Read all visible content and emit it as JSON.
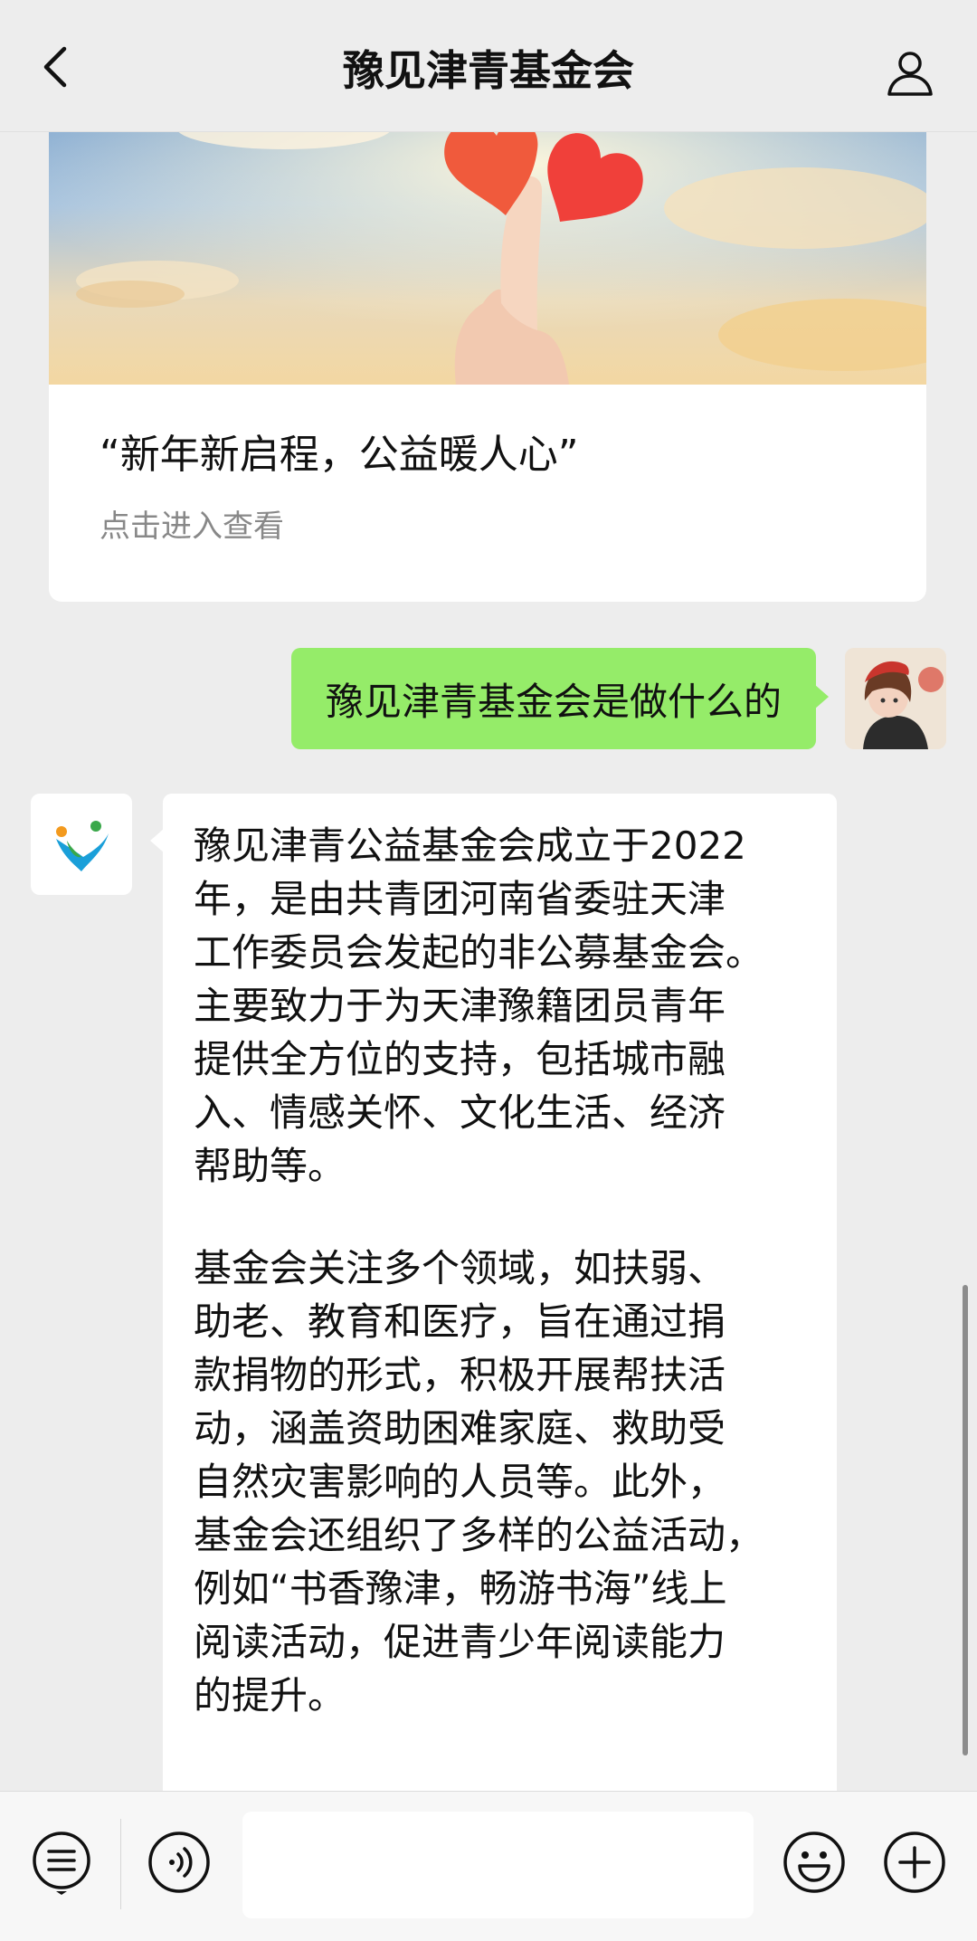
{
  "navbar": {
    "title": "豫见津青基金会",
    "back_icon": "chevron-left-icon",
    "profile_icon": "person-icon"
  },
  "article_card": {
    "title": "“新年新启程，公益暖人心”",
    "subtitle": "点击进入查看",
    "image_description_icon": "hearts-in-hand-image"
  },
  "messages": {
    "outgoing": {
      "text": "豫见津青基金会是做什么的"
    },
    "incoming": {
      "paragraph_1": "豫见津青公益基金会成立于2022\n年，是由共青团河南省委驻天津\n工作委员会发起的非公募基金会。\n主要致力于为天津豫籍团员青年\n提供全方位的支持，包括城市融\n入、情感关怀、文化生活、经济\n帮助等。",
      "paragraph_2": "基金会关注多个领域，如扶弱、\n助老、教育和医疗，旨在通过捐\n款捐物的形式，积极开展帮扶活\n动，涵盖资助困难家庭、救助受\n自然灾害影响的人员等。此外，\n基金会还组织了多样的公益活动，\n例如“书香豫津，畅游书海”线上\n阅读活动，促进青少年阅读能力\n的提升。"
    }
  },
  "input_bar": {
    "menu_icon": "list-menu-icon",
    "voice_icon": "voice-icon",
    "input_value": "",
    "emoji_icon": "emoji-icon",
    "plus_icon": "plus-icon"
  },
  "colors": {
    "background": "#ededed",
    "outgoing_bubble": "#95ec69",
    "incoming_bubble": "#ffffff",
    "secondary_text": "#888888"
  }
}
